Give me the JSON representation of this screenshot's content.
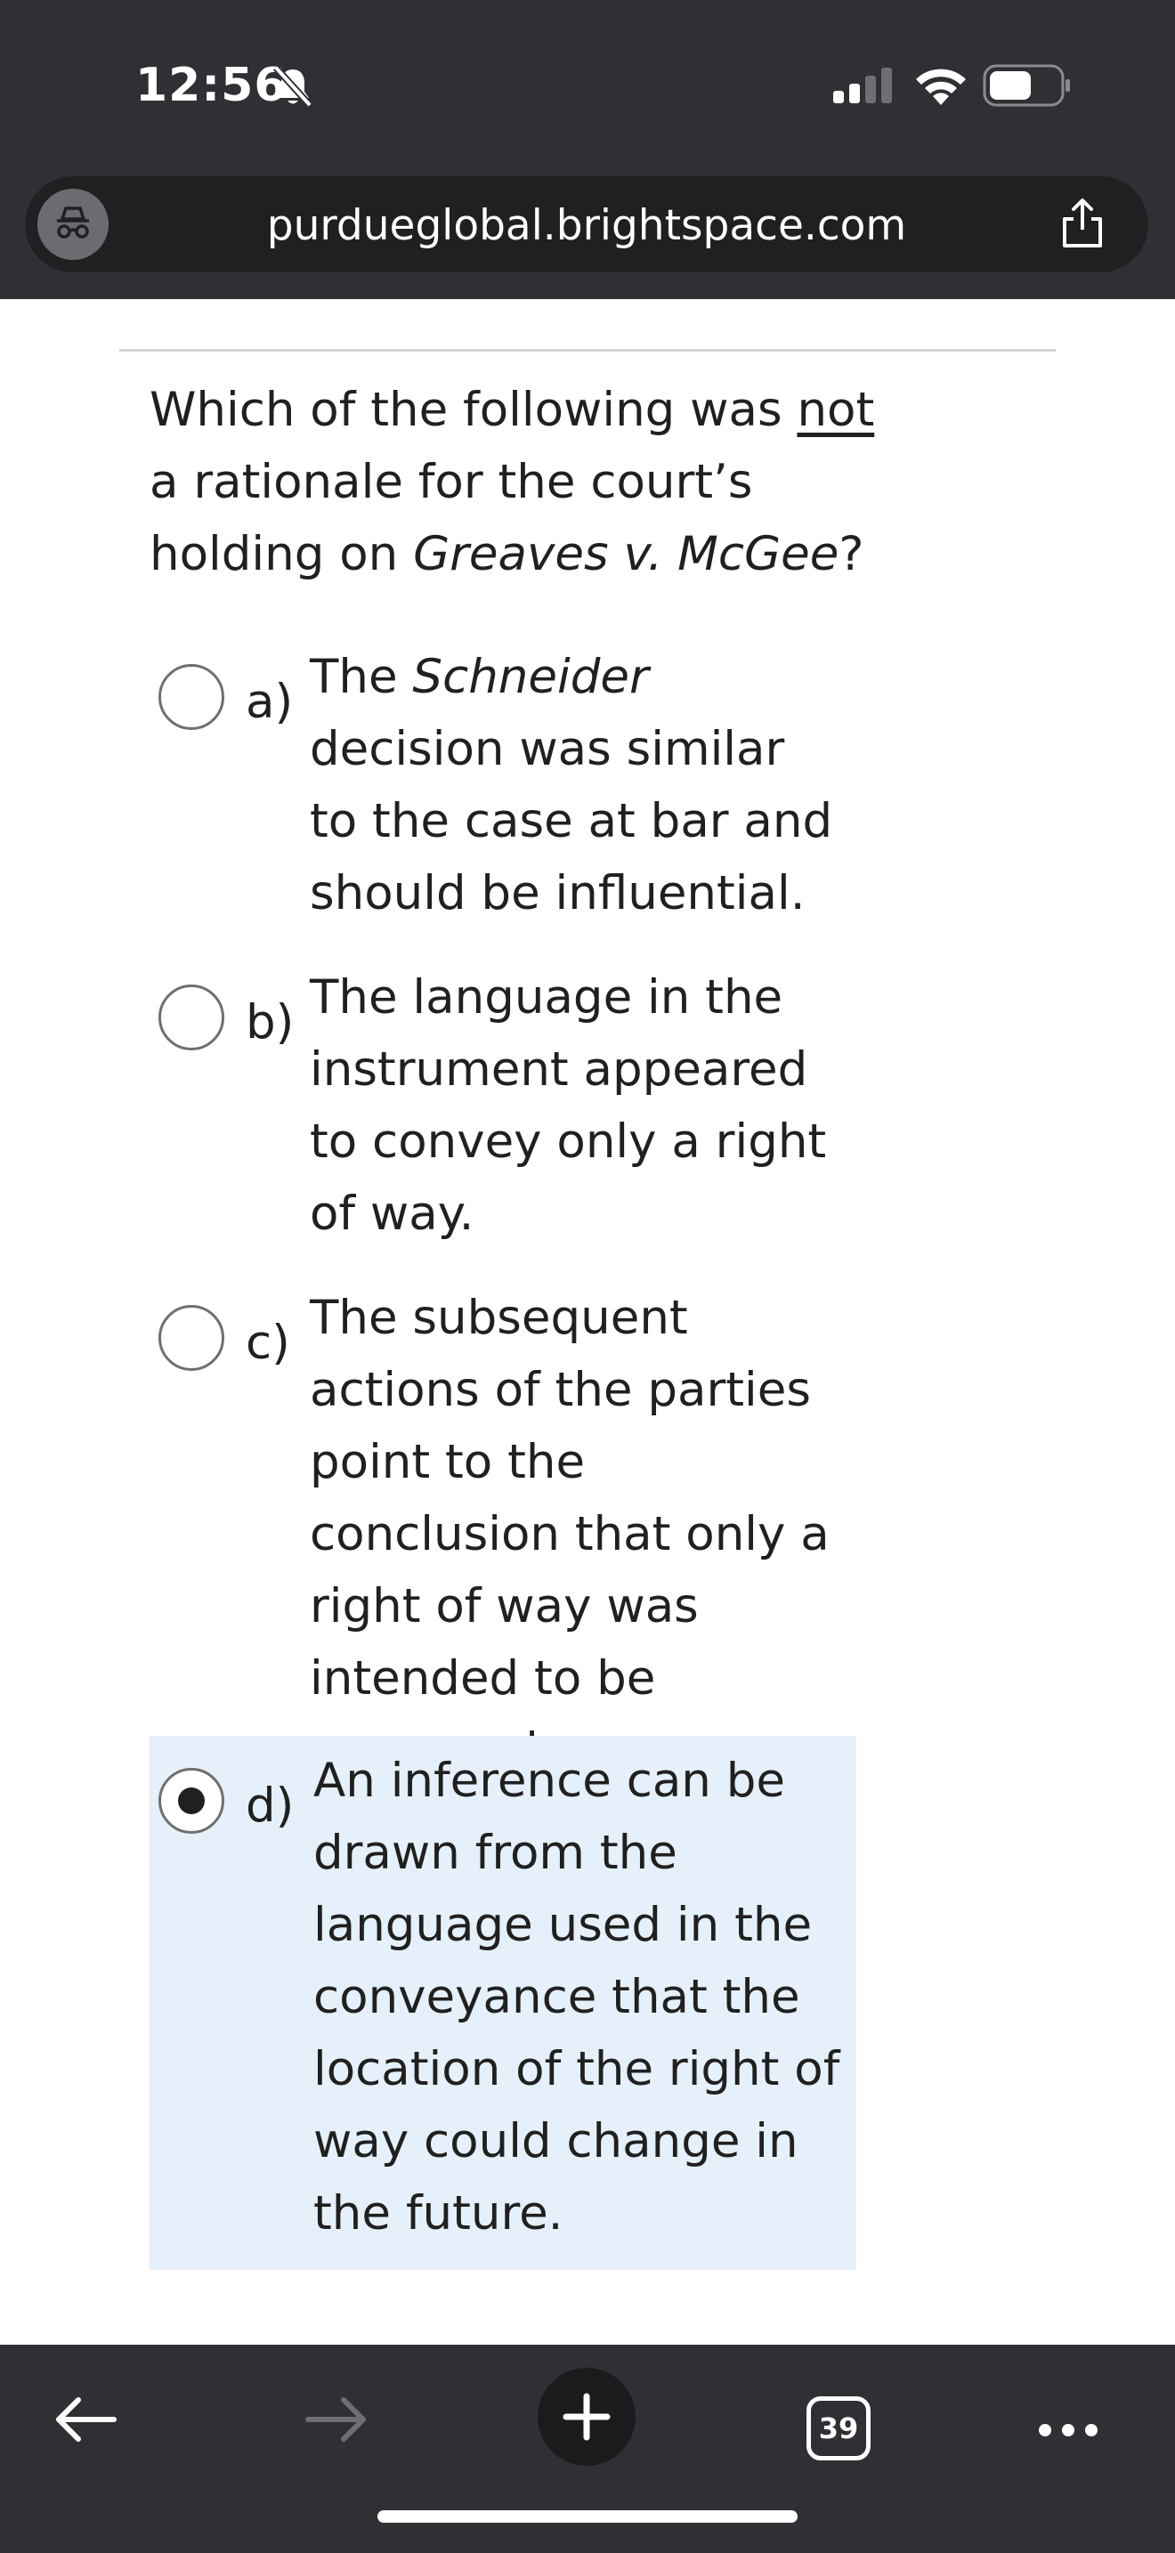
{
  "status_bar": {
    "time": "12:56",
    "silent_icon": "bell-slash-icon",
    "signal_icon": "cellular-signal-icon",
    "wifi_icon": "wifi-icon",
    "battery_icon": "battery-icon"
  },
  "browser": {
    "url": "purdueglobal.brightspace.com",
    "privacy_icon": "private-browsing-icon",
    "share_icon": "share-icon"
  },
  "question": {
    "text_before": "Which of the following was ",
    "emphasis": "not",
    "text_middle": " a rationale for the court’s holding on ",
    "case_name": "Greaves v. McGee",
    "text_after": "?"
  },
  "options": [
    {
      "letter": "a)",
      "prefix": "The ",
      "case": "Schneider",
      "rest": " decision was similar to the case at bar and should be influential.",
      "selected": false
    },
    {
      "letter": "b)",
      "text": "The language in the instrument appeared to convey only a right of way.",
      "selected": false
    },
    {
      "letter": "c)",
      "text": "The subsequent actions of the parties point to the conclusion that only a right of way was intended to be conveyed.",
      "selected": false
    },
    {
      "letter": "d)",
      "text": "An inference can be drawn from the language used in the conveyance that the location of the right of way could change in the future.",
      "selected": true
    }
  ],
  "toolbar": {
    "back_icon": "arrow-left-icon",
    "forward_icon": "arrow-right-icon",
    "new_tab_icon": "plus-icon",
    "tabs_count": "39",
    "more_icon": "ellipsis-icon"
  },
  "colors": {
    "chrome_bg": "#2e3033",
    "url_bar_bg": "#1f2022",
    "selected_option_bg": "#e6f0fa",
    "text": "#202020"
  }
}
